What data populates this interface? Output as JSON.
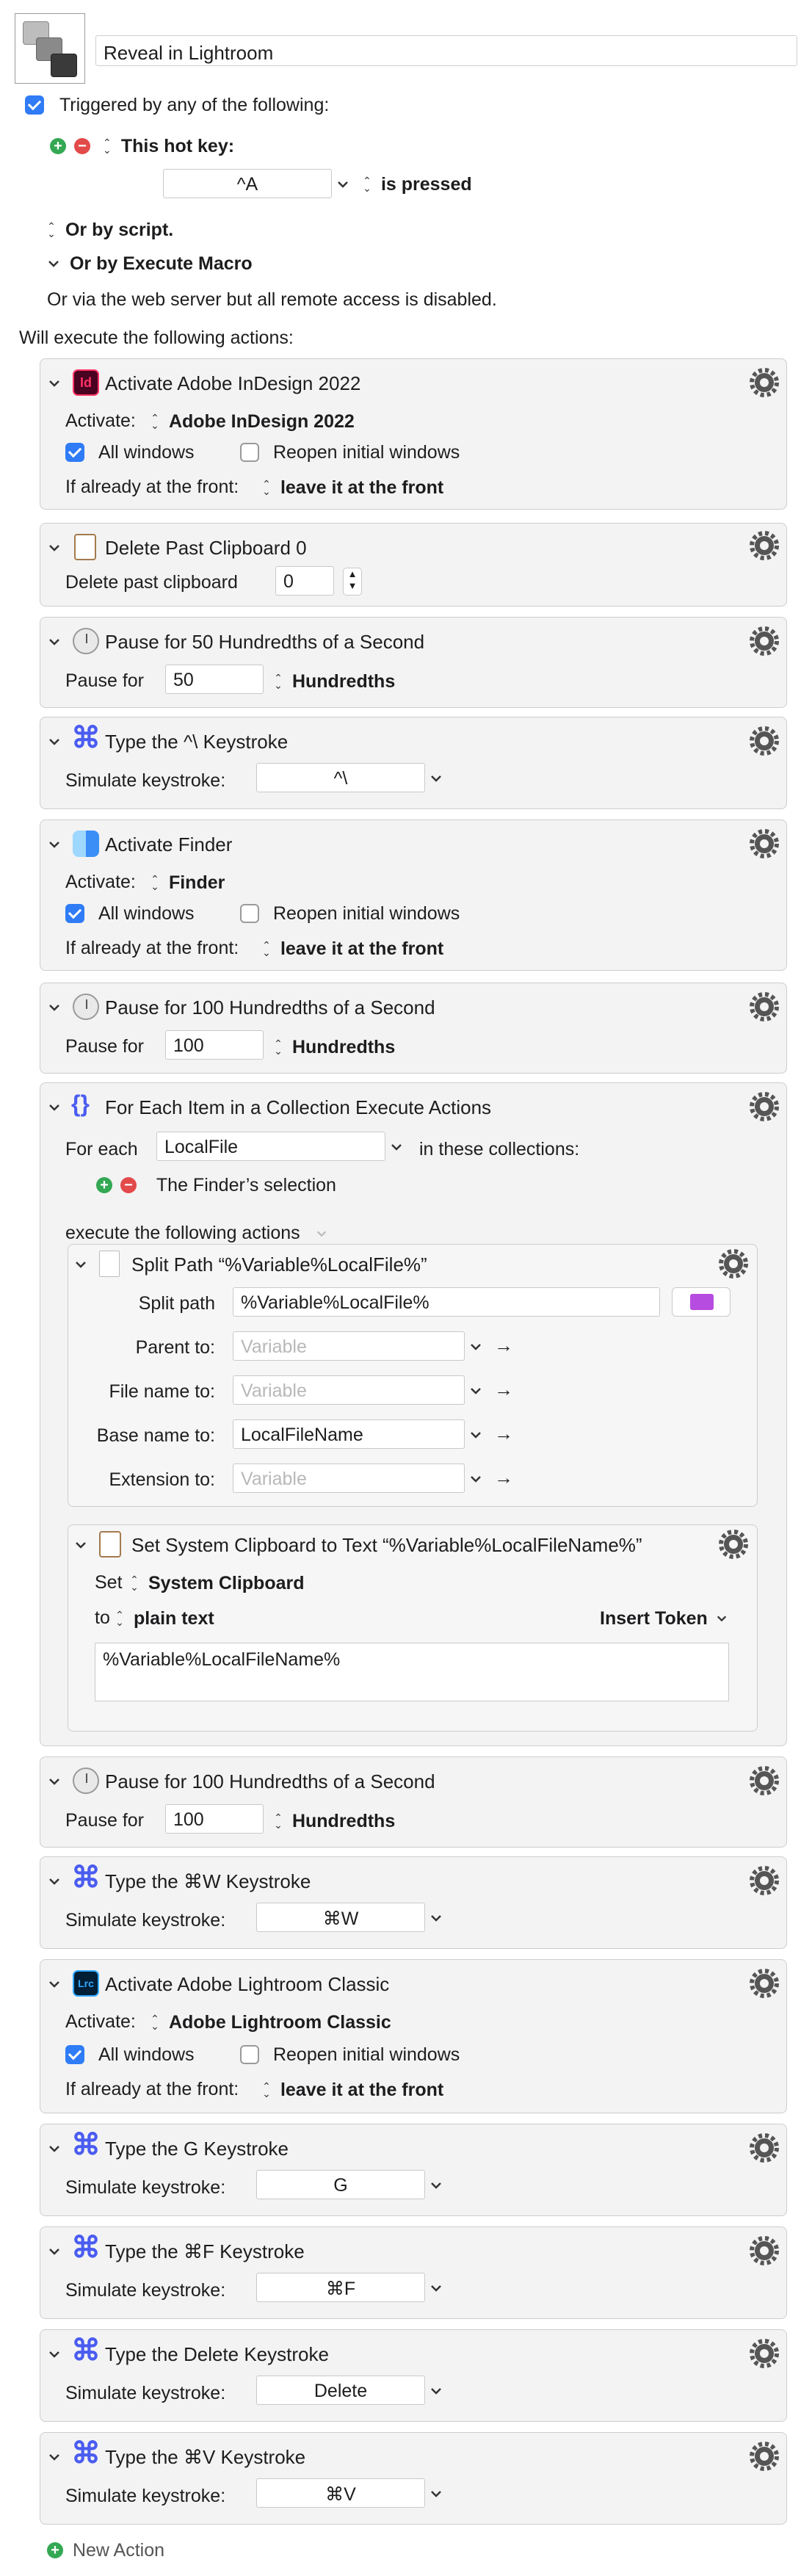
{
  "macro": {
    "name": "Reveal in Lightroom",
    "trigger_label": "Triggered by any of the following:",
    "hotkey_label": "This hot key:",
    "hotkey_value": "^A",
    "hotkey_state": "is pressed",
    "or_script": "Or by script.",
    "or_execute_macro": "Or by Execute Macro",
    "web_server_note": "Or via the web server but all remote access is disabled.",
    "will_execute": "Will execute the following actions:",
    "new_action": "New Action"
  },
  "labels": {
    "activate": "Activate:",
    "all_windows": "All windows",
    "reopen": "Reopen initial windows",
    "if_front": "If already at the front:",
    "leave_front": "leave it at the front",
    "pause_for": "Pause for",
    "hundredths": "Hundredths",
    "simulate_keystroke": "Simulate keystroke:"
  },
  "actions": {
    "a1": {
      "title": "Activate Adobe InDesign 2022",
      "app": "Adobe InDesign 2022",
      "icon_text": "Id"
    },
    "a2": {
      "title": "Delete Past Clipboard 0",
      "label": "Delete past clipboard",
      "value": "0"
    },
    "a3": {
      "title": "Pause for 50 Hundredths of a Second",
      "value": "50"
    },
    "a4": {
      "title": "Type the ^\\ Keystroke",
      "key": "^\\"
    },
    "a5": {
      "title": "Activate Finder",
      "app": "Finder"
    },
    "a6": {
      "title": "Pause for 100 Hundredths of a Second",
      "value": "100"
    },
    "a7": {
      "title": "For Each Item in a Collection Execute Actions",
      "for_each": "For each",
      "variable": "LocalFile",
      "in_collections": "in these collections:",
      "collection": "The Finder’s selection",
      "execute_label": "execute the following actions",
      "split": {
        "title": "Split Path “%Variable%LocalFile%”",
        "split_path_label": "Split path",
        "split_path_value": "%Variable%LocalFile%",
        "parent_label": "Parent to:",
        "parent_placeholder": "Variable",
        "filename_label": "File name to:",
        "filename_placeholder": "Variable",
        "basename_label": "Base name to:",
        "basename_value": "LocalFileName",
        "extension_label": "Extension to:",
        "extension_placeholder": "Variable"
      },
      "set_clip": {
        "title": "Set System Clipboard to Text “%Variable%LocalFileName%”",
        "set_label": "Set",
        "set_target": "System Clipboard",
        "to_label": "to",
        "to_value": "plain text",
        "insert_token": "Insert Token",
        "text": "%Variable%LocalFileName%"
      }
    },
    "a8": {
      "title": "Pause for 100 Hundredths of a Second",
      "value": "100"
    },
    "a9": {
      "title": "Type the ⌘W Keystroke",
      "key": "⌘W"
    },
    "a10": {
      "title": "Activate Adobe Lightroom Classic",
      "app": "Adobe Lightroom Classic",
      "icon_text": "Lrc"
    },
    "a11": {
      "title": "Type the G Keystroke",
      "key": "G"
    },
    "a12": {
      "title": "Type the ⌘F Keystroke",
      "key": "⌘F"
    },
    "a13": {
      "title": "Type the Delete Keystroke",
      "key": "Delete"
    },
    "a14": {
      "title": "Type the ⌘V Keystroke",
      "key": "⌘V"
    }
  },
  "icons": {
    "gear": "gear-icon",
    "chevron": "chevron-down-icon",
    "command": "⌘",
    "arrow": "→"
  }
}
